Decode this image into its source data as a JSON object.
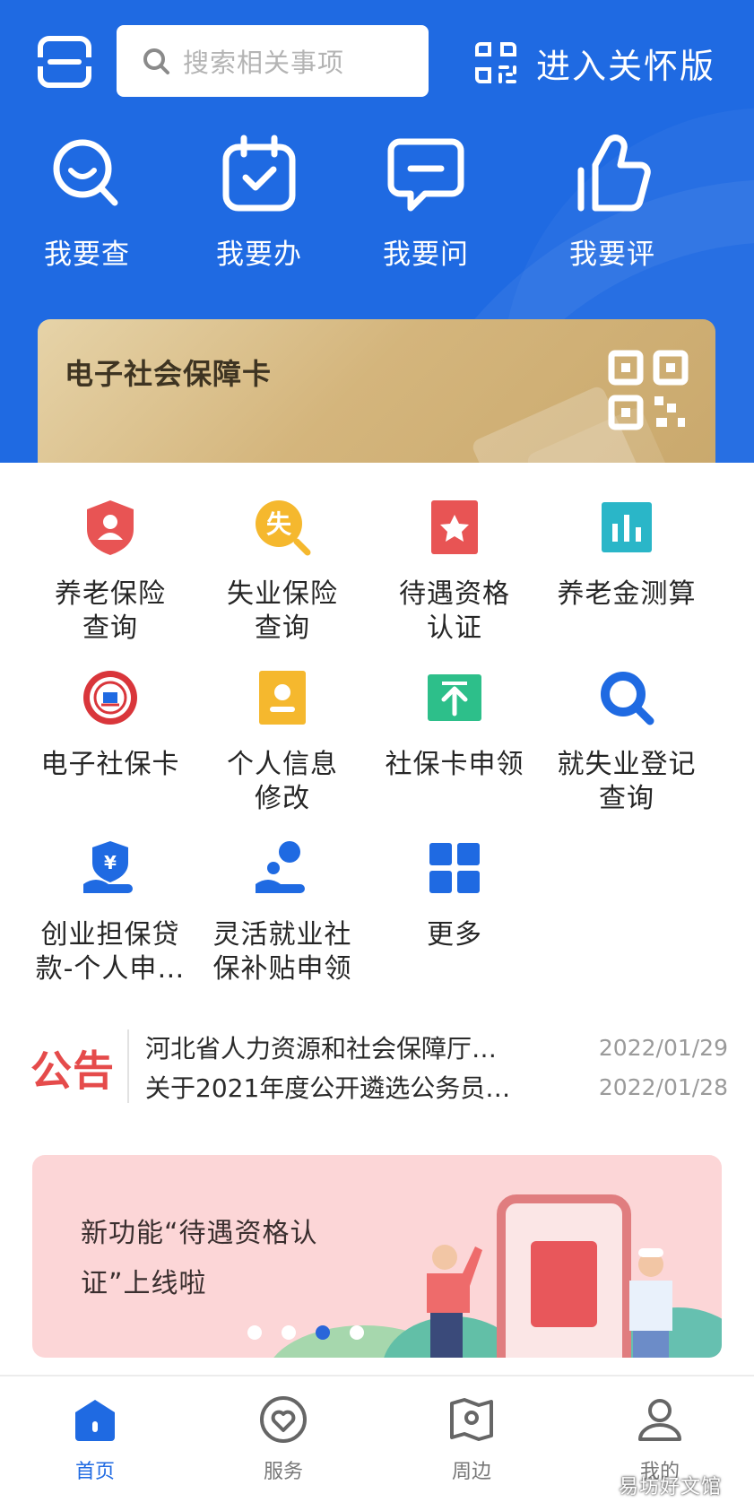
{
  "header": {
    "search_placeholder": "搜索相关事项",
    "care_mode_label": "进入关怀版",
    "quick_actions": [
      {
        "label": "我要查",
        "icon": "search-face-icon"
      },
      {
        "label": "我要办",
        "icon": "calendar-check-icon"
      },
      {
        "label": "我要问",
        "icon": "chat-bubble-icon"
      },
      {
        "label": "我要评",
        "icon": "thumbs-up-icon"
      }
    ]
  },
  "social_card": {
    "title": "电子社会保障卡",
    "icon": "qr-code-icon"
  },
  "services": [
    {
      "line1": "养老保险",
      "line2": "查询",
      "icon": "shield-user-icon",
      "color": "#e85454"
    },
    {
      "line1": "失业保险",
      "line2": "查询",
      "icon": "unemployment-search-icon",
      "color": "#f5b82e"
    },
    {
      "line1": "待遇资格",
      "line2": "认证",
      "icon": "bookmark-star-icon",
      "color": "#e85454"
    },
    {
      "line1": "养老金测算",
      "line2": "",
      "icon": "bar-chart-icon",
      "color": "#2ab6c8"
    },
    {
      "line1": "电子社保卡",
      "line2": "",
      "icon": "social-security-badge-icon",
      "color": "#d9363b"
    },
    {
      "line1": "个人信息",
      "line2": "修改",
      "icon": "id-card-icon",
      "color": "#f5b82e"
    },
    {
      "line1": "社保卡申领",
      "line2": "",
      "icon": "upload-box-icon",
      "color": "#2dbf8a"
    },
    {
      "line1": "就失业登记",
      "line2": "查询",
      "icon": "magnifier-icon",
      "color": "#1f6ae2"
    },
    {
      "line1": "创业担保贷",
      "line2": "款-个人申…",
      "icon": "hand-yuan-icon",
      "color": "#1f6ae2"
    },
    {
      "line1": "灵活就业社",
      "line2": "保补贴申领",
      "icon": "hand-coin-icon",
      "color": "#1f6ae2"
    },
    {
      "line1": "更多",
      "line2": "",
      "icon": "grid-icon",
      "color": "#1f6ae2"
    }
  ],
  "notice": {
    "tag": "公告",
    "items": [
      {
        "title": "河北省人力资源和社会保障厅…",
        "date": "2022/01/29"
      },
      {
        "title": "关于2021年度公开遴选公务员…",
        "date": "2022/01/28"
      }
    ]
  },
  "banner": {
    "line1": "新功能“待遇资格认",
    "line2": "证”上线啦",
    "active_slide": 3,
    "slide_count": 4
  },
  "tabbar": [
    {
      "label": "首页",
      "icon": "home-icon",
      "active": true
    },
    {
      "label": "服务",
      "icon": "heart-circle-icon",
      "active": false
    },
    {
      "label": "周边",
      "icon": "map-pin-icon",
      "active": false
    },
    {
      "label": "我的",
      "icon": "user-icon",
      "active": false
    }
  ],
  "watermark": "易坊好文馆",
  "colors": {
    "primary": "#1f6ae2",
    "notice_red": "#e54b4b",
    "card_gold": "#d4b57c",
    "banner_pink": "#fcd6d7"
  }
}
